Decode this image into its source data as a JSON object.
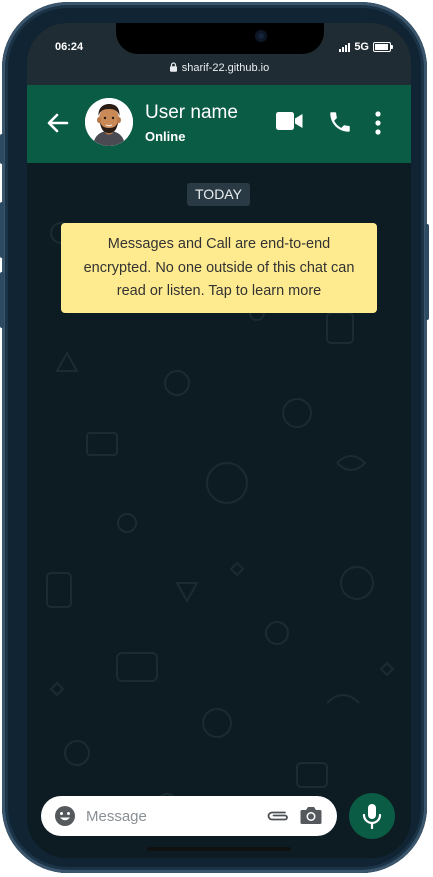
{
  "status_bar": {
    "time": "06:24",
    "network": "5G"
  },
  "browser": {
    "url": "sharif-22.github.io"
  },
  "header": {
    "name": "User name",
    "status": "Online"
  },
  "chat": {
    "date_label": "TODAY",
    "encryption_lines": [
      "Messages and Call are end-to-end",
      "encrypted. No one outside of this chat can",
      "read or listen. Tap to learn more"
    ]
  },
  "composer": {
    "placeholder": "Message"
  },
  "colors": {
    "header": "#0b5c45",
    "status_bar": "#1f2c33",
    "chat_background": "#0d1c22",
    "notice": "#ffeb8f",
    "frame": "#102434"
  },
  "icons": {
    "back": "arrow-left-icon",
    "video": "video-camera-icon",
    "call": "phone-icon",
    "menu": "more-vertical-icon",
    "emoji": "emoji-icon",
    "attach": "paperclip-icon",
    "camera": "camera-icon",
    "mic": "microphone-icon",
    "lock": "lock-icon"
  }
}
